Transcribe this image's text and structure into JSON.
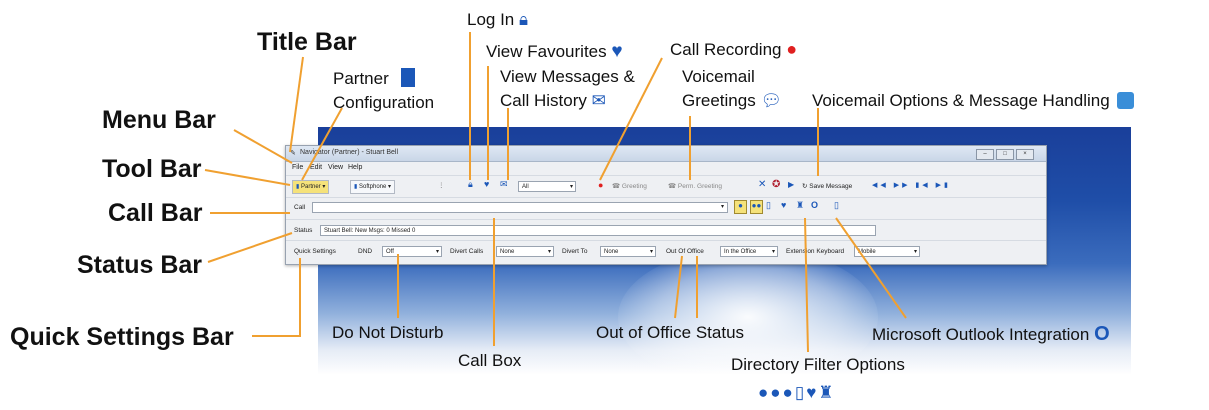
{
  "callouts": {
    "title_bar": "Title Bar",
    "menu_bar": "Menu Bar",
    "tool_bar": "Tool Bar",
    "call_bar": "Call Bar",
    "status_bar": "Status Bar",
    "quick_settings_bar": "Quick Settings Bar",
    "partner_config_line1": "Partner",
    "partner_config_line2": "Configuration",
    "log_in": "Log In",
    "view_favourites": "View Favourites",
    "view_messages_line1": "View Messages &",
    "view_messages_line2": "Call History",
    "call_recording": "Call Recording",
    "voicemail_greetings_line1": "Voicemail",
    "voicemail_greetings_line2": "Greetings",
    "voicemail_options": "Voicemail Options & Message Handling",
    "do_not_disturb": "Do Not Disturb",
    "call_box": "Call Box",
    "out_of_office_status": "Out of Office Status",
    "directory_filter_options": "Directory Filter Options",
    "outlook_integration": "Microsoft Outlook Integration"
  },
  "window": {
    "title": "Navigator (Partner) - Stuart Bell",
    "menu": [
      "File",
      "Edit",
      "View",
      "Help"
    ],
    "toolbar": {
      "partner": "Partner",
      "softphone": "Softphone",
      "all": "All",
      "greeting": "Greeting",
      "perm_greeting": "Perm. Greeting",
      "save_message": "Save Message"
    },
    "call_label": "Call",
    "status_label": "Status",
    "status_value": "Stuart Bell: New Msgs: 0 Missed 0",
    "quick_settings": {
      "label": "Quick Settings",
      "dnd_label": "DND",
      "dnd_value": "Off",
      "divert_calls_label": "Divert Calls",
      "divert_calls_value": "None",
      "divert_to_label": "Divert To",
      "divert_to_value": "None",
      "out_of_office_label": "Out Of Office",
      "out_of_office_value": "In the Office",
      "extension_label": "Extension Keyboard",
      "extension_value": "Mobile"
    }
  },
  "colors": {
    "leader": "#f0a030",
    "icon_blue": "#1b57b8",
    "record_red": "#e02020"
  }
}
